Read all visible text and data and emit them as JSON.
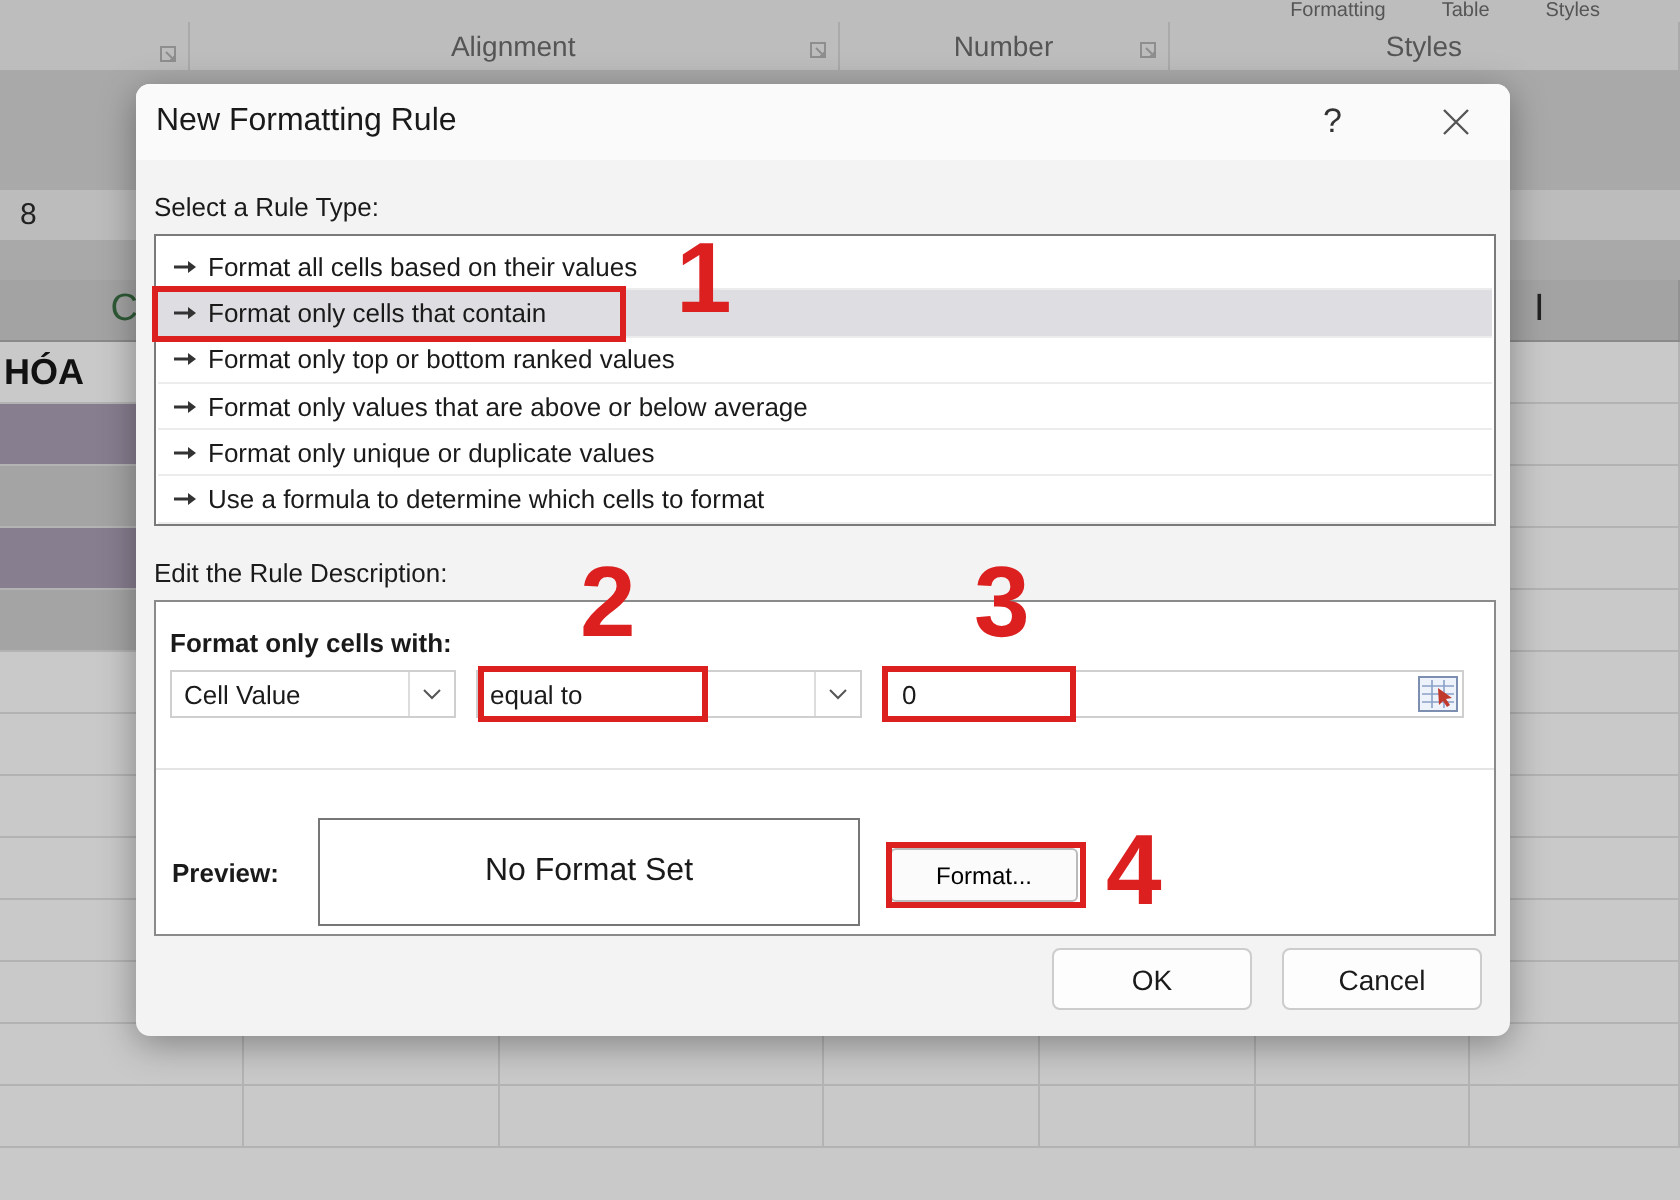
{
  "ribbon": {
    "top_labels": [
      "Formatting",
      "Table",
      "Styles"
    ],
    "groups": [
      "Alignment",
      "Number",
      "Styles"
    ]
  },
  "sheet": {
    "name_box": "8",
    "columns": [
      "C",
      "I"
    ],
    "rows": [
      {
        "cell": "HÓA",
        "color": "#c9c9c9"
      },
      {
        "color": "#877e8f"
      },
      {
        "color": "#a4a4a4"
      },
      {
        "color": "#877e8f"
      },
      {
        "color": "#a4a4a4"
      }
    ]
  },
  "dialog": {
    "title": "New Formatting Rule",
    "help": "?",
    "rule_type_label": "Select a Rule Type:",
    "rule_types": [
      {
        "label": "Format all cells based on their values",
        "selected": false
      },
      {
        "label": "Format only cells that contain",
        "selected": true
      },
      {
        "label": "Format only top or bottom ranked values",
        "selected": false
      },
      {
        "label": "Format only values that are above or below average",
        "selected": false
      },
      {
        "label": "Format only unique or duplicate values",
        "selected": false
      },
      {
        "label": "Use a formula to determine which cells to format",
        "selected": false
      }
    ],
    "description_label": "Edit the Rule Description:",
    "condition_label": "Format only cells with:",
    "dropdowns": [
      "Cell Value",
      "equal to"
    ],
    "value": "0",
    "preview_label": "Preview:",
    "preview_text": "No Format Set",
    "format_button": "Format...",
    "buttons": [
      "OK",
      "Cancel"
    ]
  },
  "annotations": [
    "1",
    "2",
    "3",
    "4"
  ]
}
